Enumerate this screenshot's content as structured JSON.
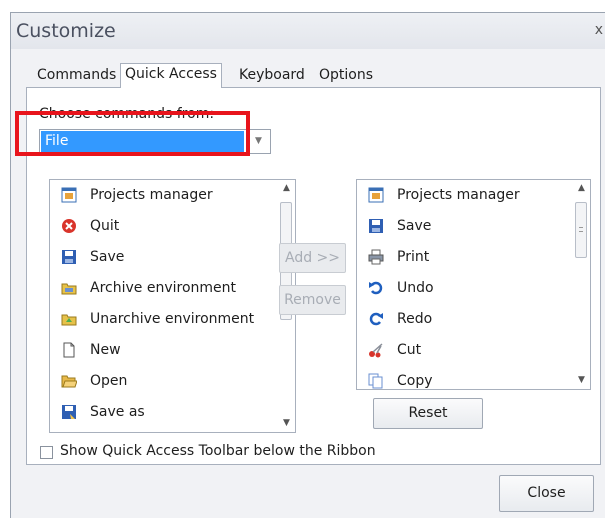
{
  "window": {
    "title": "Customize",
    "close_glyph": "x"
  },
  "tabs": [
    {
      "label": "Commands",
      "active": false
    },
    {
      "label": "Quick Access",
      "active": true
    },
    {
      "label": "Keyboard",
      "active": false
    },
    {
      "label": "Options",
      "active": false
    }
  ],
  "choose_commands": {
    "label": "Choose commands from:",
    "selected": "File",
    "highlight_color": "#e8141c",
    "selection_color": "#3399ff"
  },
  "available_commands": [
    {
      "label": "Projects manager",
      "icon": "projects-manager-icon"
    },
    {
      "label": "Quit",
      "icon": "quit-icon"
    },
    {
      "label": "Save",
      "icon": "save-icon"
    },
    {
      "label": "Archive environment",
      "icon": "archive-icon"
    },
    {
      "label": "Unarchive environment",
      "icon": "unarchive-icon"
    },
    {
      "label": "New",
      "icon": "new-document-icon"
    },
    {
      "label": "Open",
      "icon": "open-folder-icon"
    },
    {
      "label": "Save as",
      "icon": "save-as-icon"
    }
  ],
  "quick_access_commands": [
    {
      "label": "Projects manager",
      "icon": "projects-manager-icon"
    },
    {
      "label": "Save",
      "icon": "save-icon"
    },
    {
      "label": "Print",
      "icon": "print-icon"
    },
    {
      "label": "Undo",
      "icon": "undo-icon"
    },
    {
      "label": "Redo",
      "icon": "redo-icon"
    },
    {
      "label": "Cut",
      "icon": "cut-icon"
    },
    {
      "label": "Copy",
      "icon": "copy-icon"
    }
  ],
  "buttons": {
    "add": "Add >>",
    "remove": "Remove",
    "reset": "Reset",
    "close": "Close"
  },
  "show_below_ribbon": {
    "label": "Show Quick Access Toolbar below the Ribbon",
    "checked": false
  }
}
